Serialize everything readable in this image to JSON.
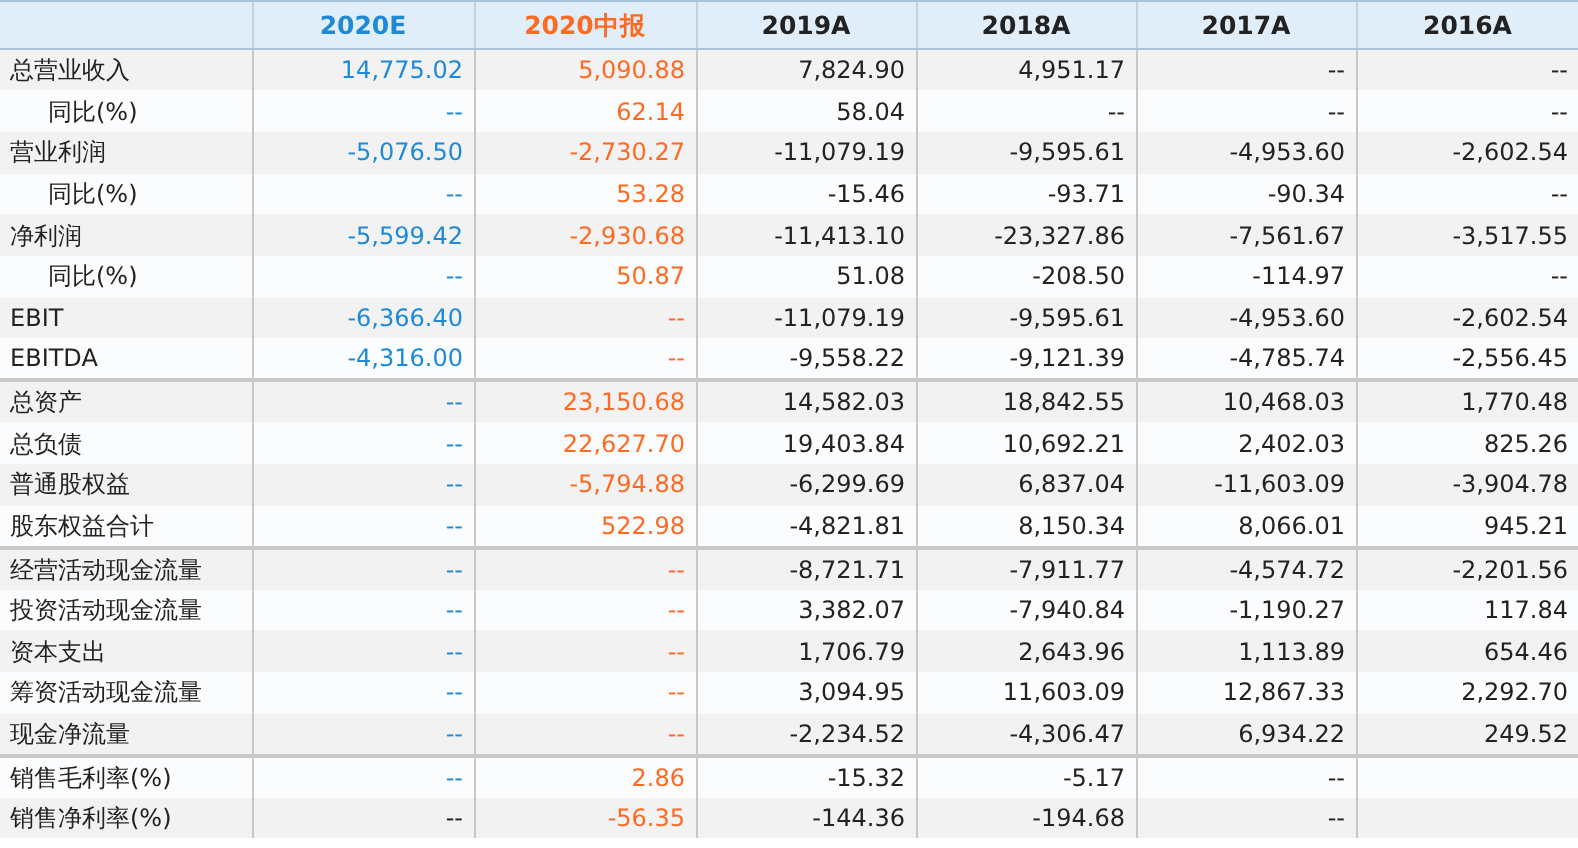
{
  "table": {
    "columns": [
      {
        "label": "2020E",
        "color": "#1e8ad6"
      },
      {
        "label": "2020中报",
        "color": "#ff6a22"
      },
      {
        "label": "2019A",
        "color": "#222222"
      },
      {
        "label": "2018A",
        "color": "#222222"
      },
      {
        "label": "2017A",
        "color": "#222222"
      },
      {
        "label": "2016A",
        "color": "#222222"
      }
    ],
    "groups": [
      {
        "rows": [
          {
            "label": "总营业收入",
            "cells": [
              "14,775.02",
              "5,090.88",
              "7,824.90",
              "4,951.17",
              "--",
              "--"
            ],
            "children": [
              {
                "label": "同比(%)",
                "cells": [
                  "--",
                  "62.14",
                  "58.04",
                  "--",
                  "--",
                  "--"
                ]
              }
            ]
          },
          {
            "label": "营业利润",
            "cells": [
              "-5,076.50",
              "-2,730.27",
              "-11,079.19",
              "-9,595.61",
              "-4,953.60",
              "-2,602.54"
            ],
            "children": [
              {
                "label": "同比(%)",
                "cells": [
                  "--",
                  "53.28",
                  "-15.46",
                  "-93.71",
                  "-90.34",
                  "--"
                ]
              }
            ]
          },
          {
            "label": "净利润",
            "cells": [
              "-5,599.42",
              "-2,930.68",
              "-11,413.10",
              "-23,327.86",
              "-7,561.67",
              "-3,517.55"
            ],
            "children": [
              {
                "label": "同比(%)",
                "cells": [
                  "--",
                  "50.87",
                  "51.08",
                  "-208.50",
                  "-114.97",
                  "--"
                ]
              }
            ]
          },
          {
            "label": "EBIT",
            "cells": [
              "-6,366.40",
              "--",
              "-11,079.19",
              "-9,595.61",
              "-4,953.60",
              "-2,602.54"
            ]
          },
          {
            "label": "EBITDA",
            "cells": [
              "-4,316.00",
              "--",
              "-9,558.22",
              "-9,121.39",
              "-4,785.74",
              "-2,556.45"
            ]
          }
        ]
      },
      {
        "rows": [
          {
            "label": "总资产",
            "cells": [
              "--",
              "23,150.68",
              "14,582.03",
              "18,842.55",
              "10,468.03",
              "1,770.48"
            ]
          },
          {
            "label": "总负债",
            "cells": [
              "--",
              "22,627.70",
              "19,403.84",
              "10,692.21",
              "2,402.03",
              "825.26"
            ]
          },
          {
            "label": "普通股权益",
            "cells": [
              "--",
              "-5,794.88",
              "-6,299.69",
              "6,837.04",
              "-11,603.09",
              "-3,904.78"
            ]
          },
          {
            "label": "股东权益合计",
            "cells": [
              "--",
              "522.98",
              "-4,821.81",
              "8,150.34",
              "8,066.01",
              "945.21"
            ]
          }
        ]
      },
      {
        "rows": [
          {
            "label": "经营活动现金流量",
            "cells": [
              "--",
              "--",
              "-8,721.71",
              "-7,911.77",
              "-4,574.72",
              "-2,201.56"
            ]
          },
          {
            "label": "投资活动现金流量",
            "cells": [
              "--",
              "--",
              "3,382.07",
              "-7,940.84",
              "-1,190.27",
              "117.84"
            ]
          },
          {
            "label": "资本支出",
            "cells": [
              "--",
              "--",
              "1,706.79",
              "2,643.96",
              "1,113.89",
              "654.46"
            ]
          },
          {
            "label": "筹资活动现金流量",
            "cells": [
              "--",
              "--",
              "3,094.95",
              "11,603.09",
              "12,867.33",
              "2,292.70"
            ]
          },
          {
            "label": "现金净流量",
            "cells": [
              "--",
              "--",
              "-2,234.52",
              "-4,306.47",
              "6,934.22",
              "249.52"
            ]
          }
        ]
      },
      {
        "rows": [
          {
            "label": "销售毛利率(%)",
            "cells": [
              "--",
              "2.86",
              "-15.32",
              "-5.17",
              "--",
              null
            ]
          },
          {
            "label": "销售净利率(%)",
            "cells": [
              {
                "text": "--",
                "color": "#222222"
              },
              "-56.35",
              "-144.36",
              "-194.68",
              "--",
              null
            ]
          }
        ]
      }
    ]
  }
}
